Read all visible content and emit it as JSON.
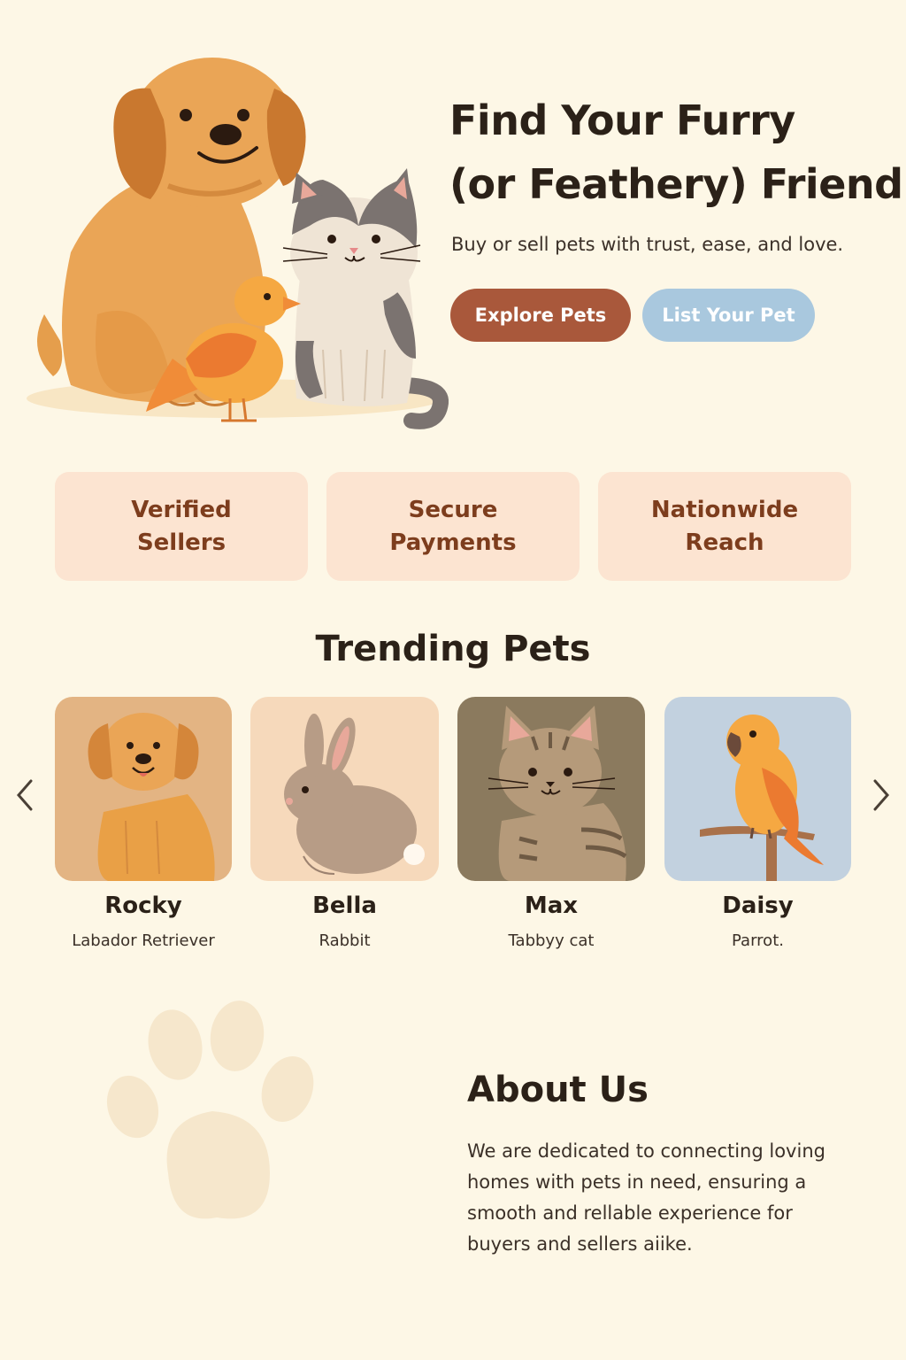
{
  "hero": {
    "title_line1": "Find Your Furry",
    "title_line2": "(or Feathery) Friend",
    "subtitle": "Buy or sell pets with trust, ease, and love.",
    "explore_label": "Explore Pets",
    "list_label": "List Your Pet"
  },
  "features": [
    {
      "line1": "Verified",
      "line2": "Sellers"
    },
    {
      "line1": "Secure",
      "line2": "Payments"
    },
    {
      "line1": "Nationwide",
      "line2": "Reach"
    }
  ],
  "trending": {
    "title": "Trending Pets",
    "pets": [
      {
        "name": "Rocky",
        "breed": "Labador Retriever",
        "icon": "dog-icon"
      },
      {
        "name": "Bella",
        "breed": "Rabbit",
        "icon": "rabbit-icon"
      },
      {
        "name": "Max",
        "breed": "Tabbyy cat",
        "icon": "cat-icon"
      },
      {
        "name": "Daisy",
        "breed": "Parrot.",
        "icon": "parrot-icon"
      }
    ]
  },
  "about": {
    "title": "About Us",
    "line1": "We are dedicated to connecting loving",
    "line2": "homes with pets in need, ensuring a",
    "line3": "smooth and rellable experience for",
    "line4": "buyers and sellers aiike."
  },
  "colors": {
    "background": "#fdf7e6",
    "primary_button": "#a9583b",
    "secondary_button": "#a9c8de",
    "feature_bg": "#fce4d1",
    "feature_text": "#7d3d1d"
  }
}
